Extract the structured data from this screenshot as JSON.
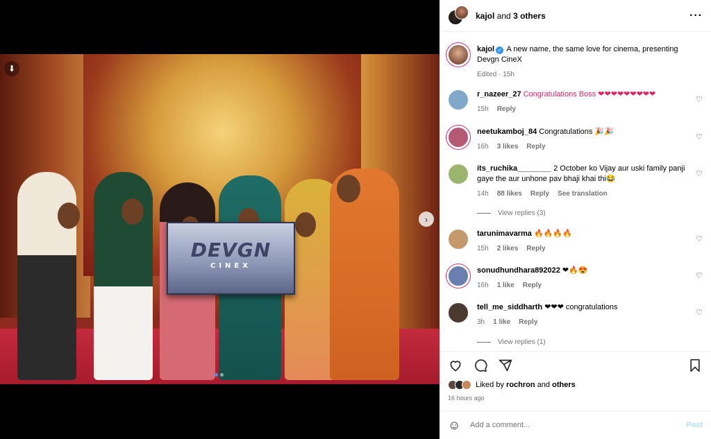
{
  "header": {
    "username": "kajol",
    "and_text": "and",
    "others": "3 others"
  },
  "media": {
    "sign_title": "DEVGN",
    "sign_sub": "CINEX"
  },
  "caption": {
    "username": "kajol",
    "text": "A new name, the same love for cinema, presenting Devgn CineX",
    "meta": "Edited · 15h"
  },
  "comments": [
    {
      "user": "r_nazeer_27",
      "text": "Congratulations Boss ❤❤❤❤❤❤❤❤❤",
      "time": "15h",
      "likes": "",
      "reply": "Reply",
      "color": "#7fa8c9"
    },
    {
      "user": "neetukamboj_84",
      "text": "Congratulations 🎉🎉",
      "time": "16h",
      "likes": "3 likes",
      "reply": "Reply",
      "color": "#b45a74"
    },
    {
      "user": "its_ruchika________",
      "text": "2 October ko Vijay aur uski family panji gaye the aur unhone pav bhaji khai thi😂",
      "time": "14h",
      "likes": "88 likes",
      "reply": "Reply",
      "translate": "See translation",
      "color": "#9bb56e"
    },
    {
      "user": "tarunimavarma",
      "text": "🔥🔥🔥🔥",
      "time": "15h",
      "likes": "2 likes",
      "reply": "Reply",
      "color": "#c49a6c"
    },
    {
      "user": "sonudhundhara892022",
      "text": "❤🔥😍",
      "time": "16h",
      "likes": "1 like",
      "reply": "Reply",
      "color": "#6a7fb0"
    },
    {
      "user": "tell_me_siddharth",
      "text": "❤❤❤ congratulations",
      "time": "3h",
      "likes": "1 like",
      "reply": "Reply",
      "color": "#4a3a30"
    }
  ],
  "view_replies": [
    "View replies (3)",
    "View replies (1)"
  ],
  "likes": {
    "prefix": "Liked by",
    "user": "rochron",
    "and_text": "and",
    "others": "others"
  },
  "time_ago": "16 hours ago",
  "comment_box": {
    "placeholder": "Add a comment...",
    "post_label": "Post"
  },
  "colors": {
    "accent": "#3897f0",
    "post_disabled": "#b2dffc",
    "muted": "#737373"
  }
}
